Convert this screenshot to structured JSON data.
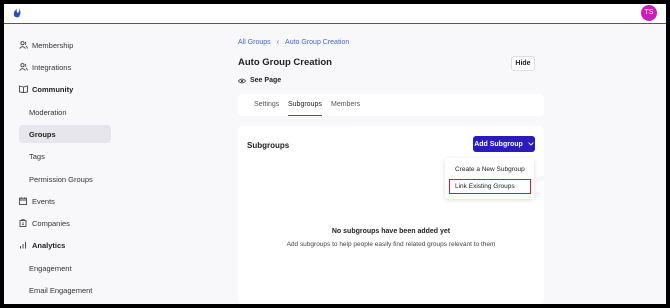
{
  "header": {
    "avatar_initials": "TS",
    "brand_color": "#5b3bd6",
    "avatar_color": "#c81fb5"
  },
  "sidebar": {
    "items": [
      {
        "label": "Membership",
        "icon": "users-icon"
      },
      {
        "label": "Integrations",
        "icon": "users-icon"
      },
      {
        "label": "Community",
        "icon": "book-icon"
      },
      {
        "label": "Moderation"
      },
      {
        "label": "Groups"
      },
      {
        "label": "Tags"
      },
      {
        "label": "Permission Groups"
      },
      {
        "label": "Events",
        "icon": "calendar-icon"
      },
      {
        "label": "Companies",
        "icon": "building-icon"
      },
      {
        "label": "Analytics",
        "icon": "bar-chart-icon"
      },
      {
        "label": "Engagement"
      },
      {
        "label": "Email Engagement"
      }
    ]
  },
  "breadcrumb": {
    "root": "All Groups",
    "separator": "‹",
    "current": "Auto Group Creation"
  },
  "page": {
    "title": "Auto Group Creation",
    "hide_label": "Hide",
    "see_page_label": "See Page"
  },
  "tabs": [
    {
      "label": "Settings"
    },
    {
      "label": "Subgroups"
    },
    {
      "label": "Members"
    }
  ],
  "subgroups": {
    "title": "Subgroups",
    "add_button_label": "Add Subgroup",
    "dropdown": [
      {
        "label": "Create a New Subgroup"
      },
      {
        "label": "Link Existing Groups"
      }
    ],
    "empty_title": "No subgroups have been added yet",
    "empty_description": "Add subgroups to help people easily find related groups relevant to them"
  }
}
